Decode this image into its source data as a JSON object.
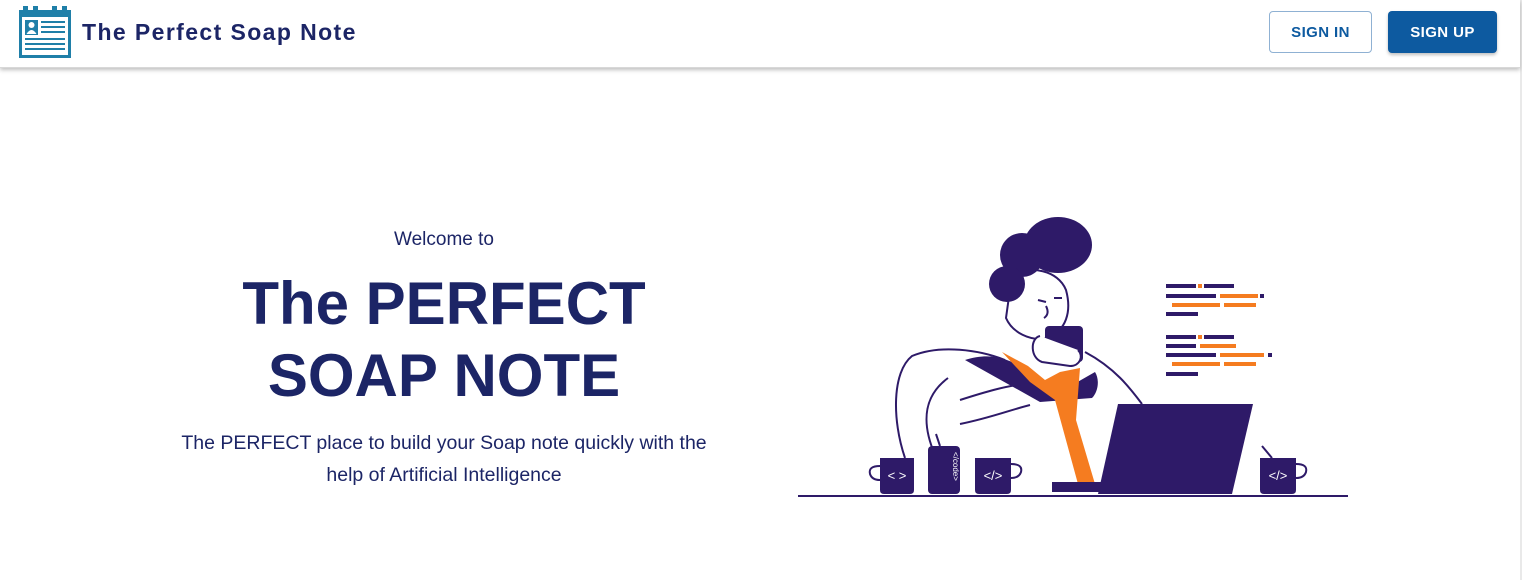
{
  "header": {
    "logo_icon": "medical-record-icon",
    "title": "The Perfect Soap Note",
    "signin_label": "SIGN IN",
    "signup_label": "SIGN UP"
  },
  "hero": {
    "welcome": "Welcome to",
    "title_line1": "The PERFECT",
    "title_line2": "SOAP NOTE",
    "subtitle_line1": "The PERFECT place to build your Soap note quickly with the",
    "subtitle_line2": "help of Artificial Intelligence"
  },
  "illustration": {
    "icon": "developer-at-laptop-illustration",
    "mug_left_label": "< >",
    "mug_right_label": "</>",
    "mug_small_label": "</>",
    "can_label": "</code>"
  },
  "colors": {
    "brand_navy": "#1c2566",
    "accent_blue": "#0d5aa0",
    "illustration_purple": "#2e1a68",
    "illustration_orange": "#f57c20",
    "logo_teal": "#1f7fa8"
  }
}
